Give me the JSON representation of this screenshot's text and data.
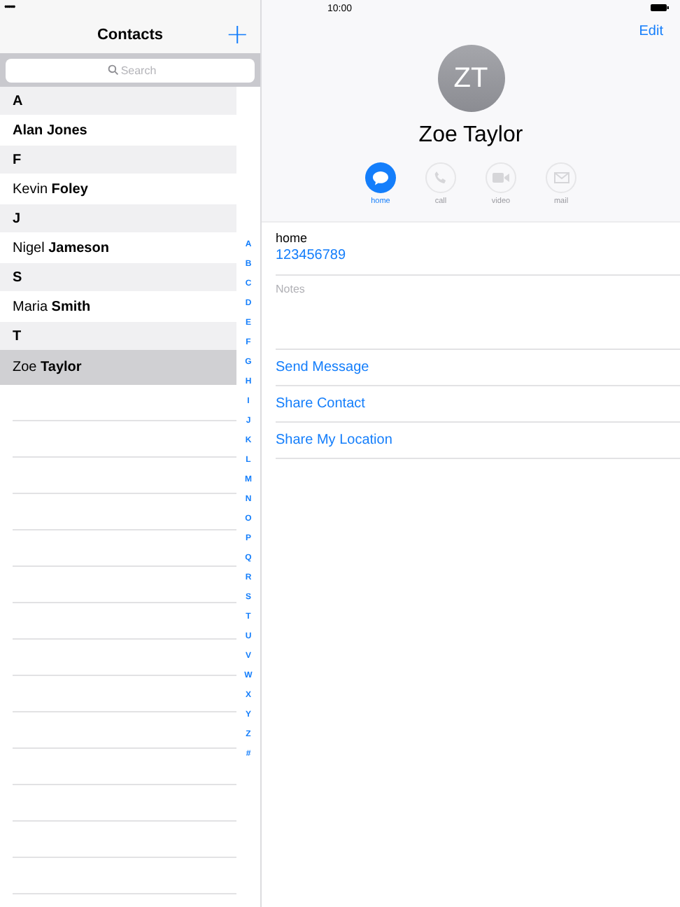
{
  "status_bar": {
    "signal": "•••••",
    "time": "10:00"
  },
  "sidebar": {
    "title": "Contacts",
    "add_button": "+",
    "search": {
      "placeholder": "Search"
    },
    "sections": [
      {
        "letter": "A",
        "contacts": [
          {
            "name": "Alan Jones",
            "bold": true,
            "selected": false
          }
        ]
      },
      {
        "letter": "F",
        "contacts": [
          {
            "name": "Kevin **Foley**",
            "bold": false,
            "selected": false
          }
        ]
      },
      {
        "letter": "J",
        "contacts": [
          {
            "name": "Nigel **Jameson**",
            "bold": false,
            "selected": false
          }
        ]
      },
      {
        "letter": "S",
        "contacts": [
          {
            "name": "Maria **Smith**",
            "bold": false,
            "selected": false
          }
        ]
      },
      {
        "letter": "T",
        "contacts": [
          {
            "name": "Zoe  **Taylor**",
            "bold": false,
            "selected": true
          }
        ]
      }
    ],
    "index": [
      "A",
      "B",
      "C",
      "D",
      "E",
      "F",
      "G",
      "H",
      "I",
      "J",
      "K",
      "L",
      "M",
      "N",
      "O",
      "P",
      "Q",
      "R",
      "S",
      "T",
      "U",
      "V",
      "W",
      "X",
      "Y",
      "Z",
      "#"
    ]
  },
  "detail": {
    "edit": "Edit",
    "initials": "ZT",
    "name": "Zoe  Taylor",
    "actions": [
      {
        "kind": "message",
        "label": "home",
        "disabled": false
      },
      {
        "kind": "call",
        "label": "call",
        "disabled": true
      },
      {
        "kind": "video",
        "label": "video",
        "disabled": true
      },
      {
        "kind": "mail",
        "label": "mail",
        "disabled": true
      }
    ],
    "phone": {
      "label": "home",
      "value": "123456789"
    },
    "notes": {
      "placeholder": "Notes"
    },
    "links": [
      "Send Message",
      "Share Contact",
      "Share My Location"
    ]
  }
}
